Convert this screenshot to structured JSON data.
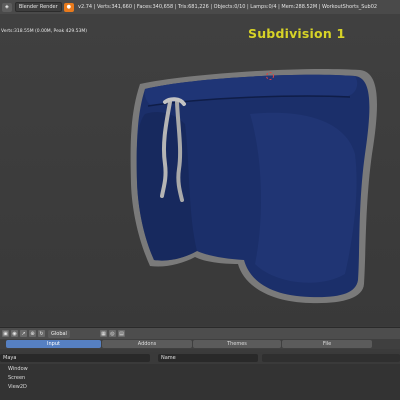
{
  "header": {
    "render_engine": "Blender Render",
    "stats": "v2.74 | Verts:341,660 | Faces:340,658 | Tris:681,226 | Objects:0/10 | Lamps:0/4 | Mem:288.52M | WorkoutShorts_Sub02",
    "stats_line2": "Verts:318.55M (0.00M, Peak 429.53M)"
  },
  "viewport": {
    "overlay_text": "Subdivision 1",
    "overlay_color": "#d7d327",
    "shorts_color": "#1b2f6a"
  },
  "view3d_header": {
    "orientation": "Global"
  },
  "prefs": {
    "tabs": [
      "Input",
      "Addons",
      "Themes",
      "File"
    ],
    "active_tab": "Input",
    "preset_field": "Maya",
    "name_field": "Name",
    "keymap_items": [
      "Window",
      "Screen",
      "View2D"
    ]
  }
}
